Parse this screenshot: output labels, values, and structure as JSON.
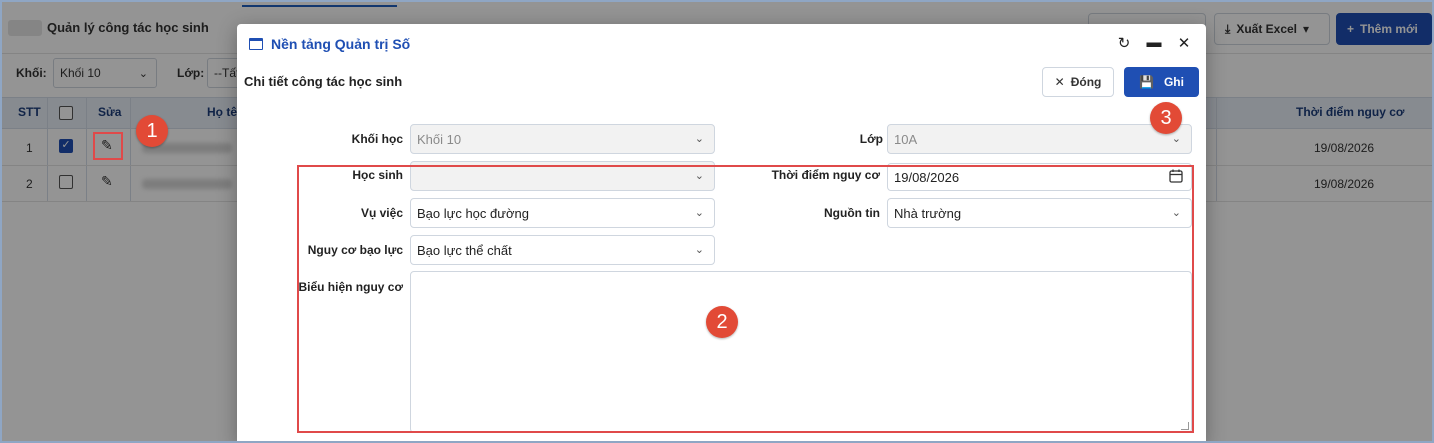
{
  "background": {
    "page_title": "Quản lý công tác học sinh",
    "buttons": {
      "export_label": "Xuất Excel",
      "add_label": "Thêm mới"
    },
    "filters": {
      "grade_label": "Khối:",
      "grade_value": "Khối 10",
      "class_label": "Lớp:",
      "class_value": "--Tất"
    },
    "table": {
      "headers": [
        "STT",
        "",
        "Sửa",
        "Họ tê",
        "Thời điểm nguy cơ"
      ],
      "rows": [
        {
          "stt": "1",
          "checked": true,
          "date": "19/08/2026"
        },
        {
          "stt": "2",
          "checked": false,
          "date": "19/08/2026"
        }
      ]
    }
  },
  "modal": {
    "window_title": "Nền tảng Quản trị Số",
    "subtitle": "Chi tiết công tác học sinh",
    "close_label": "Đóng",
    "save_label": "Ghi",
    "fields": {
      "grade": {
        "label": "Khối học",
        "value": "Khối 10"
      },
      "class": {
        "label": "Lớp",
        "value": "10A"
      },
      "student": {
        "label": "Học sinh",
        "value": ""
      },
      "risk_time": {
        "label": "Thời điểm nguy cơ",
        "value": "19/08/2026"
      },
      "incident": {
        "label": "Vụ việc",
        "value": "Bạo lực học đường"
      },
      "source": {
        "label": "Nguồn tin",
        "value": "Nhà trường"
      },
      "violence_risk": {
        "label": "Nguy cơ bạo lực",
        "value": "Bạo lực thể chất"
      },
      "risk_signs": {
        "label": "Biểu hiện nguy cơ",
        "value": ""
      }
    }
  },
  "annotations": {
    "step1": "1",
    "step2": "2",
    "step3": "3",
    "color": "#e24a36"
  }
}
